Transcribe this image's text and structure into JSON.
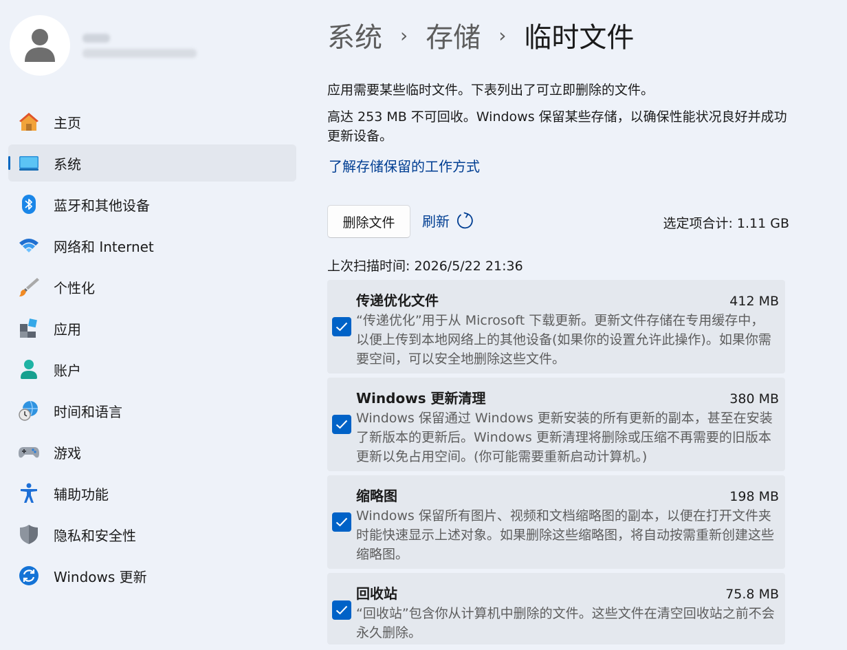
{
  "sidebar": {
    "profile": {
      "name": "",
      "email": ""
    },
    "items": [
      {
        "label": "主页",
        "icon": "home-icon",
        "active": false
      },
      {
        "label": "系统",
        "icon": "system-icon",
        "active": true
      },
      {
        "label": "蓝牙和其他设备",
        "icon": "bluetooth-icon",
        "active": false
      },
      {
        "label": "网络和 Internet",
        "icon": "wifi-icon",
        "active": false
      },
      {
        "label": "个性化",
        "icon": "brush-icon",
        "active": false
      },
      {
        "label": "应用",
        "icon": "apps-icon",
        "active": false
      },
      {
        "label": "账户",
        "icon": "account-icon",
        "active": false
      },
      {
        "label": "时间和语言",
        "icon": "globe-clock-icon",
        "active": false
      },
      {
        "label": "游戏",
        "icon": "gamepad-icon",
        "active": false
      },
      {
        "label": "辅助功能",
        "icon": "accessibility-icon",
        "active": false
      },
      {
        "label": "隐私和安全性",
        "icon": "shield-icon",
        "active": false
      },
      {
        "label": "Windows 更新",
        "icon": "update-icon",
        "active": false
      }
    ]
  },
  "breadcrumb": {
    "items": [
      "系统",
      "存储",
      "临时文件"
    ],
    "separator": "›"
  },
  "main": {
    "description_1": "应用需要某些临时文件。下表列出了可立即删除的文件。",
    "description_2": "高达 253 MB 不可回收。Windows 保留某些存储，以确保性能状况良好并成功更新设备。",
    "learn_link": "了解存储保留的工作方式",
    "delete_button": "删除文件",
    "refresh_button": "刷新",
    "total_selected": "选定项合计: 1.11 GB",
    "last_scan": "上次扫描时间: 2026/5/22 21:36"
  },
  "files": [
    {
      "title": "传递优化文件",
      "size": "412 MB",
      "description": "“传递优化”用于从 Microsoft 下载更新。更新文件存储在专用缓存中，以便上传到本地网络上的其他设备(如果你的设置允许此操作)。如果你需要空间，可以安全地删除这些文件。",
      "checked": true
    },
    {
      "title": "Windows 更新清理",
      "size": "380 MB",
      "description": "Windows 保留通过 Windows 更新安装的所有更新的副本，甚至在安装了新版本的更新后。Windows 更新清理将删除或压缩不再需要的旧版本更新以免占用空间。(你可能需要重新启动计算机。)",
      "checked": true
    },
    {
      "title": "缩略图",
      "size": "198 MB",
      "description": "Windows 保留所有图片、视频和文档缩略图的副本，以便在打开文件夹时能快速显示上述对象。如果删除这些缩略图，将自动按需重新创建这些缩略图。",
      "checked": true
    },
    {
      "title": "回收站",
      "size": "75.8 MB",
      "description": "“回收站”包含你从计算机中删除的文件。这些文件在清空回收站之前不会永久删除。",
      "checked": true
    }
  ],
  "colors": {
    "background": "#eef2f9",
    "accent": "#0067c0",
    "link": "#003e92",
    "checkbox": "#0062c7",
    "card": "#e4e8ee"
  }
}
